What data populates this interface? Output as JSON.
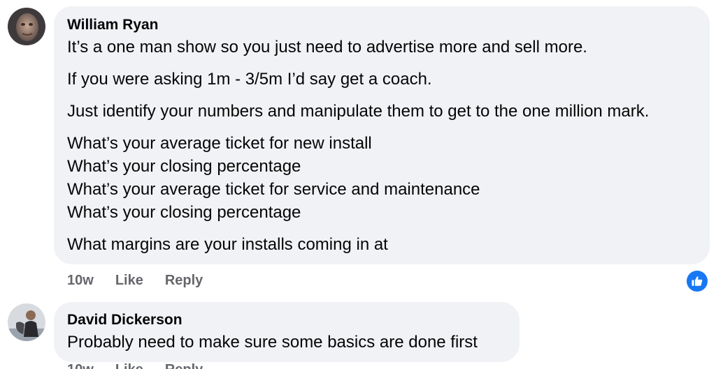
{
  "comments": [
    {
      "author": "William Ryan",
      "avatar_icon": "profile-photo",
      "paragraphs": [
        [
          "It’s a one man show so you just need to advertise more and sell more."
        ],
        [
          "If you were asking 1m - 3/5m I’d say get a coach."
        ],
        [
          "Just identify your numbers and manipulate them to get to the one million mark."
        ],
        [
          "What’s your average ticket for new install",
          "What’s your closing percentage",
          "What’s your average ticket for service and maintenance",
          "What’s your closing percentage"
        ],
        [
          "What margins are your installs coming in at"
        ]
      ],
      "time": "10w",
      "like_label": "Like",
      "reply_label": "Reply",
      "reaction_icon": "like-icon",
      "reaction_color": "#1877f2"
    },
    {
      "author": "David Dickerson",
      "avatar_icon": "profile-photo",
      "paragraphs": [
        [
          "Probably need to make sure some basics are done first"
        ]
      ],
      "time": "10w",
      "like_label": "Like",
      "reply_label": "Reply"
    }
  ],
  "colors": {
    "bubble_bg": "#f0f2f5",
    "text": "#050505",
    "secondary_text": "#65676b",
    "accent": "#1877f2"
  }
}
